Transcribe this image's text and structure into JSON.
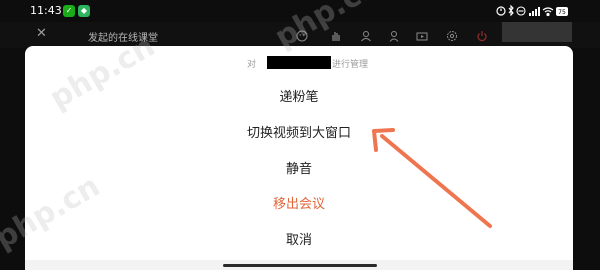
{
  "status_bar": {
    "time": "11:43",
    "battery": "75",
    "icons": [
      "wechat-icon",
      "app-icon",
      "alarm-icon",
      "bluetooth-icon",
      "dnd-icon",
      "signal-icon",
      "wifi-icon",
      "battery-icon"
    ]
  },
  "meeting": {
    "title": "发起的在线课堂",
    "tools": [
      "emoji-icon",
      "raise-hand-icon",
      "members-icon",
      "person-icon",
      "video-icon",
      "settings-icon",
      "power-icon"
    ]
  },
  "sheet": {
    "header_prefix": "对",
    "header_suffix": "进行管理",
    "items": [
      {
        "label": "递粉笔",
        "style": "normal"
      },
      {
        "label": "切换视频到大窗口",
        "style": "normal"
      },
      {
        "label": "静音",
        "style": "normal"
      },
      {
        "label": "移出会议",
        "style": "danger"
      },
      {
        "label": "取消",
        "style": "normal"
      }
    ]
  },
  "watermark": "php.cn",
  "colors": {
    "danger": "#e0663a",
    "arrow": "#ef7550",
    "sheet_bg": "#ffffff",
    "backdrop": "#0d0d0d"
  }
}
